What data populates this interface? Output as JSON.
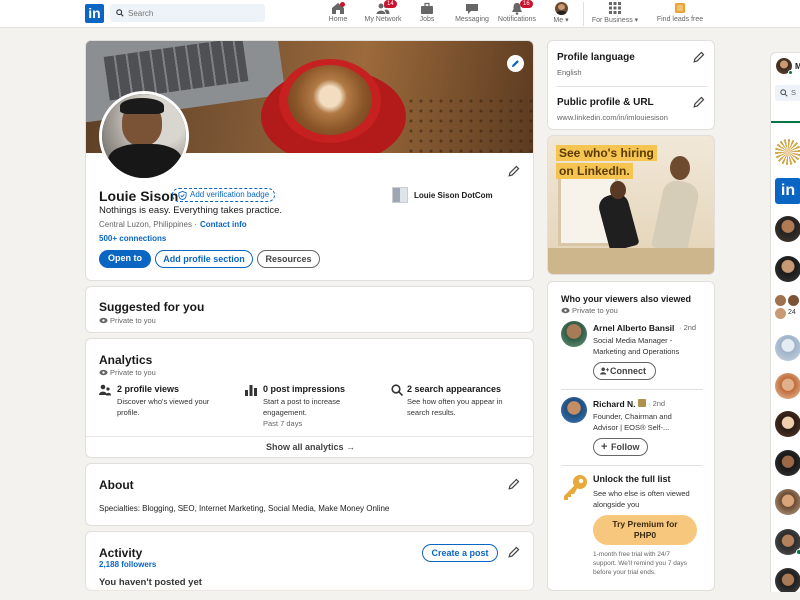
{
  "nav": {
    "logo": "in",
    "search_placeholder": "Search",
    "items": [
      {
        "label": "Home",
        "badge": ""
      },
      {
        "label": "My Network",
        "badge": "14"
      },
      {
        "label": "Jobs",
        "badge": ""
      },
      {
        "label": "Messaging",
        "badge": ""
      },
      {
        "label": "Notifications",
        "badge": "16"
      },
      {
        "label": "Me ▾",
        "badge": ""
      },
      {
        "label": "For Business ▾",
        "badge": ""
      },
      {
        "label": "Find leads free",
        "badge": ""
      }
    ]
  },
  "profile": {
    "name": "Louie Sison",
    "verify_badge": "Add verification badge",
    "headline": "Nothings is easy. Everything takes practice.",
    "location": "Central Luzon, Philippines ·",
    "contact_info": "Contact info",
    "connections": "500+ connections",
    "company": "Louie Sison DotCom",
    "btn_open_to": "Open to",
    "btn_add_section": "Add profile section",
    "btn_resources": "Resources"
  },
  "suggested": {
    "title": "Suggested for you",
    "private": "Private to you"
  },
  "analytics": {
    "title": "Analytics",
    "private": "Private to you",
    "items": [
      {
        "title": "2 profile views",
        "desc1": "Discover who's viewed your",
        "desc2": "profile.",
        "desc3": ""
      },
      {
        "title": "0 post impressions",
        "desc1": "Start a post to increase",
        "desc2": "engagement.",
        "desc3": "Past 7 days"
      },
      {
        "title": "2 search appearances",
        "desc1": "See how often you appear in",
        "desc2": "search results.",
        "desc3": ""
      }
    ],
    "show_all": "Show all analytics →"
  },
  "about": {
    "title": "About",
    "text": "Specialties: Blogging, SEO, Internet Marketing, Social Media, Make Money Online"
  },
  "activity": {
    "title": "Activity",
    "followers": "2,188 followers",
    "create_post": "Create a post",
    "empty": "You haven't posted yet"
  },
  "side": {
    "profile_language_title": "Profile language",
    "profile_language_value": "English",
    "public_profile_title": "Public profile & URL",
    "public_profile_url": "www.linkedin.com/in/imlouiesison",
    "ad_line1": "See who's hiring",
    "ad_line2": "on LinkedIn."
  },
  "viewers": {
    "title": "Who your viewers also viewed",
    "private": "Private to you",
    "people": [
      {
        "name": "Arnel Alberto Bansil",
        "degree": "· 2nd",
        "line1": "Social Media Manager -",
        "line2": "Marketing and Operations",
        "action": "Connect"
      },
      {
        "name": "Richard N.",
        "degree": "· 2nd",
        "line1": "Founder, Chairman and",
        "line2": "Advisor | EOS® Self-...",
        "action": "Follow"
      }
    ],
    "unlock_title": "Unlock the full list",
    "unlock_desc1": "See who else is often viewed",
    "unlock_desc2": "alongside you",
    "premium_btn1": "Try Premium for",
    "premium_btn2": "PHP0",
    "trial1": "1-month free trial with 24/7",
    "trial2": "support. We'll remind you 7 days",
    "trial3": "before your trial ends."
  },
  "messaging": {
    "search_placeholder": "S",
    "initial": "M",
    "count": "24"
  },
  "colors": {
    "brand": "#0a66c2",
    "background": "#f4f2ee",
    "badge": "#cb112d",
    "premium": "#f8c77e"
  }
}
